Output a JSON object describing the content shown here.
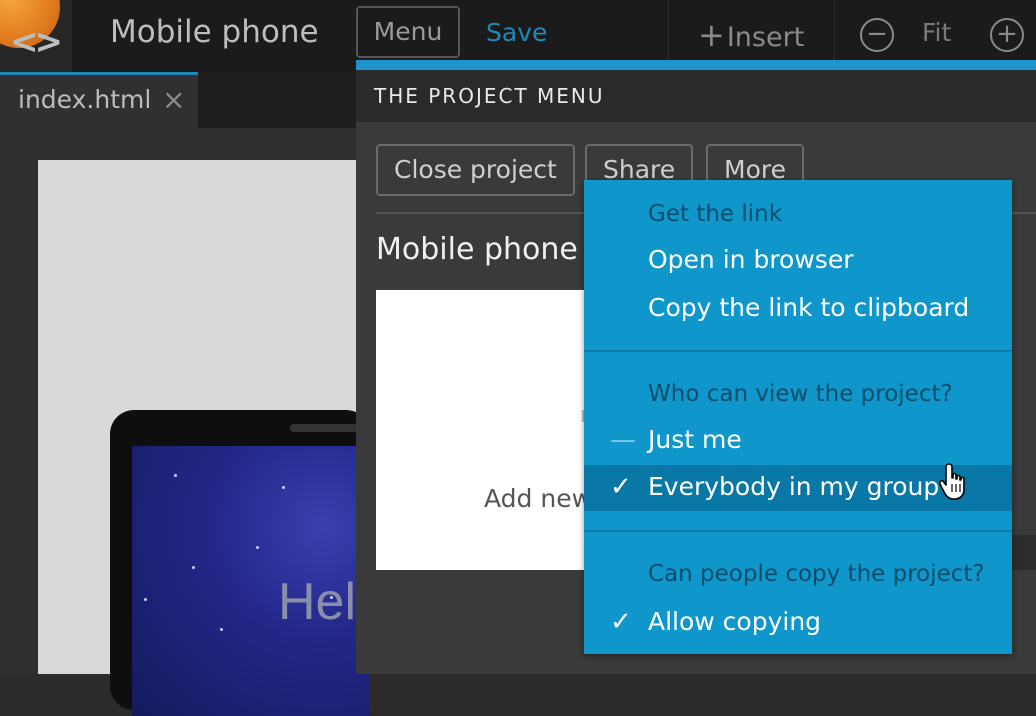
{
  "toolbar": {
    "project_title": "Mobile phone",
    "menu_label": "Menu",
    "save_label": "Save",
    "insert_label": "Insert",
    "fit_label": "Fit"
  },
  "tabs": [
    {
      "label": "index.html"
    }
  ],
  "canvas": {
    "hero_text": "Hel"
  },
  "panel": {
    "title": "THE PROJECT MENU",
    "buttons": {
      "close": "Close project",
      "share": "Share",
      "more": "More"
    },
    "project_name": "Mobile phone",
    "add_new_label": "Add new"
  },
  "share_menu": {
    "link_section": {
      "heading": "Get the link",
      "items": [
        "Open in browser",
        "Copy the link to clipboard"
      ]
    },
    "view_section": {
      "heading": "Who can view the project?",
      "items": [
        {
          "label": "Just me",
          "state": "unselected"
        },
        {
          "label": "Everybody in my group",
          "state": "selected"
        }
      ]
    },
    "copy_section": {
      "heading": "Can people copy the project?",
      "items": [
        {
          "label": "Allow copying",
          "state": "checked"
        }
      ]
    }
  },
  "colors": {
    "accent": "#1f94cc",
    "menu_bg": "#0f97cc",
    "menu_selected": "#0a78a6",
    "toolbar_bg": "#1b1b1b"
  }
}
